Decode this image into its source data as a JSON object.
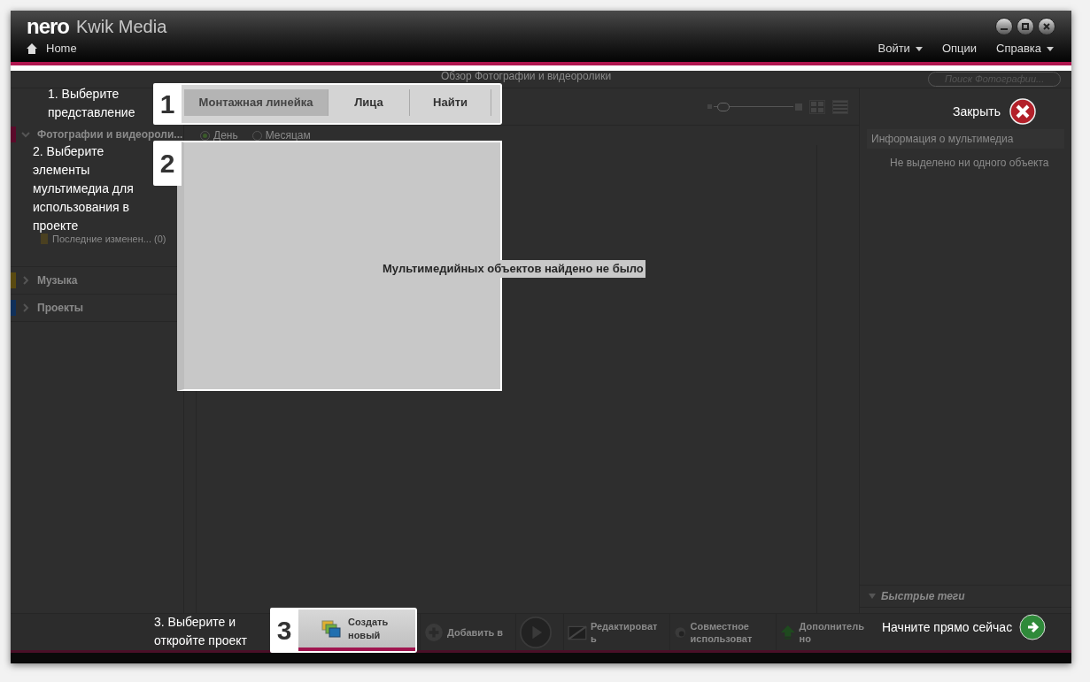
{
  "window": {
    "logo": "nero",
    "title": "Kwik Media",
    "home": "Home",
    "menu": [
      {
        "label": "Войти",
        "dropdown": true
      },
      {
        "label": "Опции",
        "dropdown": false
      },
      {
        "label": "Справка",
        "dropdown": true
      }
    ]
  },
  "header": {
    "title": "Обзор Фотографии и видеоролики",
    "search_placeholder": "Поиск Фотографии..."
  },
  "sidebar": {
    "sections": [
      {
        "label": "Фотографии и видеороли...",
        "expanded": true,
        "color": "#5a0a2a",
        "children": [
          {
            "label": "Последние изменен... (0)"
          }
        ]
      },
      {
        "label": "Музыка",
        "expanded": false,
        "color": "#5a4a10"
      },
      {
        "label": "Проекты",
        "expanded": false,
        "color": "#10305a"
      }
    ]
  },
  "zoom": {
    "level": 0.05
  },
  "view_options": [
    {
      "label": "День",
      "selected": true
    },
    {
      "label": "Месяцам",
      "selected": false
    }
  ],
  "empty_message": "Мультимедийных объектов найдено не было",
  "info_panel": {
    "title": "Информация о мультимедиа",
    "message": "Не выделено ни одного объекта",
    "quick_tags": "Быстрые теги"
  },
  "toolbar": [
    {
      "kind": "plus",
      "label": "Добавить в"
    },
    {
      "kind": "play"
    },
    {
      "kind": "edit",
      "label": "Редактироват ь"
    },
    {
      "kind": "share",
      "label": "Совместное использоват"
    },
    {
      "kind": "upload",
      "label": "Дополнитель но"
    }
  ],
  "start": {
    "label": "Начните прямо сейчас"
  },
  "guide": {
    "close": "Закрыть",
    "steps": [
      {
        "number": "1",
        "text": "1. Выберите представление",
        "tabs": [
          {
            "label": "Монтажная линейка",
            "selected": true
          },
          {
            "label": "Лица",
            "selected": false
          },
          {
            "label": "Найти",
            "selected": false
          }
        ]
      },
      {
        "number": "2",
        "text": "2. Выберите элементы мультимедиа для использования в проекте"
      },
      {
        "number": "3",
        "text": "3. Выберите и откройте проект",
        "button": "Создать новый"
      }
    ]
  }
}
